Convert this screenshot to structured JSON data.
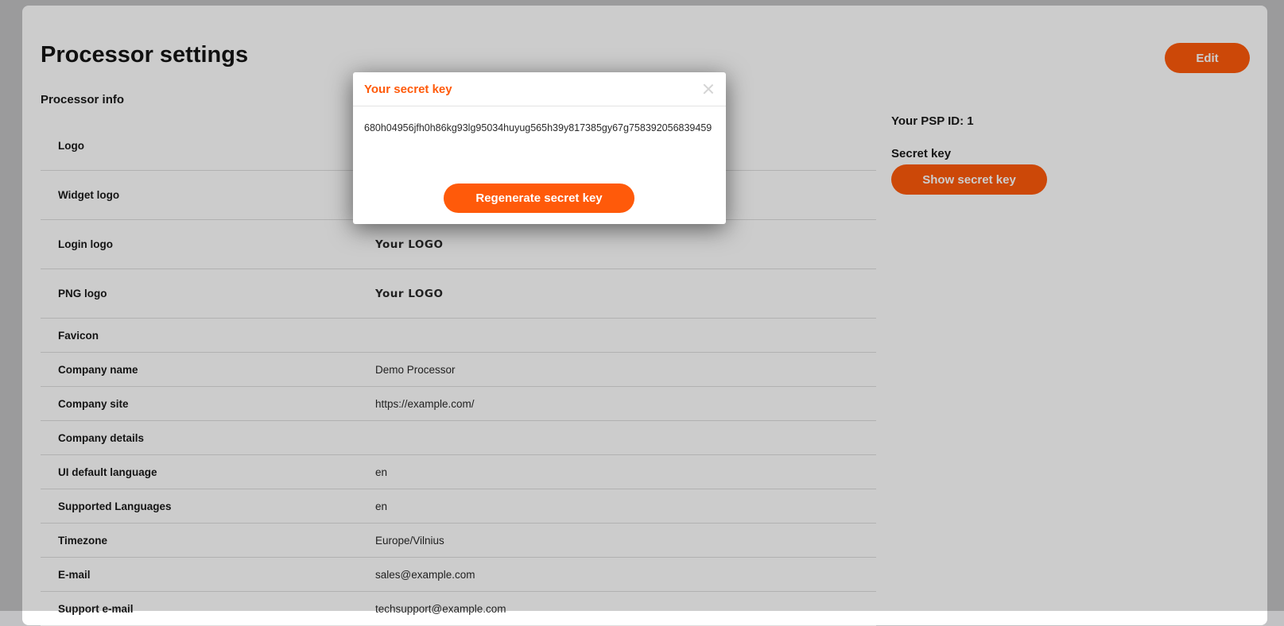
{
  "page": {
    "title": "Processor settings",
    "edit_label": "Edit",
    "section_title": "Processor info"
  },
  "rows": [
    {
      "label": "Logo",
      "value": ""
    },
    {
      "label": "Widget logo",
      "value": ""
    },
    {
      "label": "Login logo",
      "value": "Your LOGO"
    },
    {
      "label": "PNG logo",
      "value": "Your LOGO"
    },
    {
      "label": "Favicon",
      "value": ""
    },
    {
      "label": "Company name",
      "value": "Demo Processor"
    },
    {
      "label": "Company site",
      "value": "https://example.com/"
    },
    {
      "label": "Company details",
      "value": ""
    },
    {
      "label": "UI default language",
      "value": "en"
    },
    {
      "label": "Supported Languages",
      "value": "en"
    },
    {
      "label": "Timezone",
      "value": "Europe/Vilnius"
    },
    {
      "label": "E-mail",
      "value": "sales@example.com"
    },
    {
      "label": "Support e-mail",
      "value": "techsupport@example.com"
    }
  ],
  "right_panel": {
    "psp_id": "Your PSP ID: 1",
    "secret_label": "Secret key",
    "show_key_label": "Show secret key"
  },
  "modal": {
    "title": "Your secret key",
    "secret": "680h04956jfh0h86kg93lg95034huyug565h39y817385gy67g758392056839459",
    "regenerate_label": "Regenerate secret key"
  },
  "colors": {
    "accent": "#ff5a0a",
    "background": "#c2c2c4"
  }
}
